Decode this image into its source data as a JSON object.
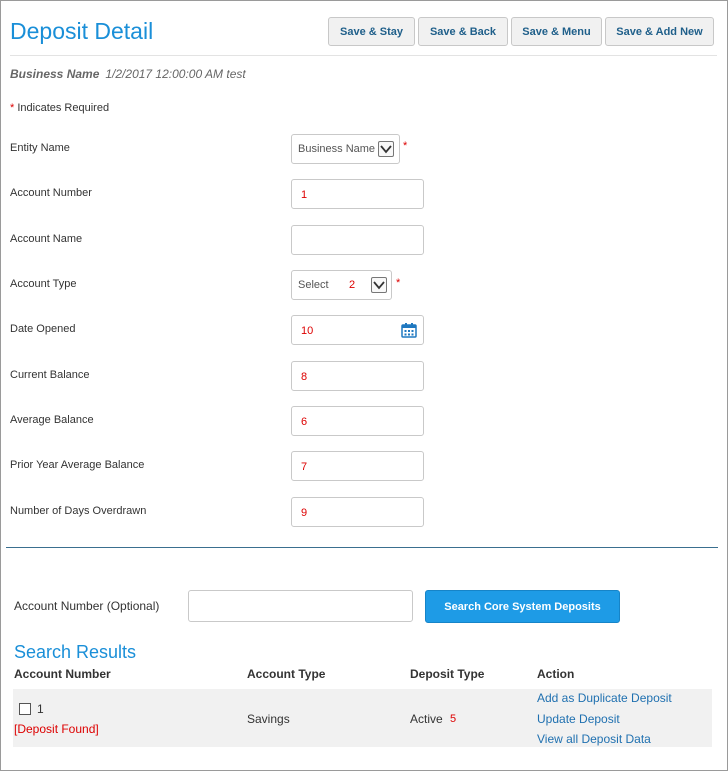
{
  "header": {
    "title": "Deposit Detail",
    "buttons": [
      "Save & Stay",
      "Save & Back",
      "Save & Menu",
      "Save & Add New"
    ]
  },
  "subtitle": {
    "business": "Business Name",
    "info": "1/2/2017 12:00:00 AM test"
  },
  "required_note": {
    "star": "*",
    "text": " Indicates Required"
  },
  "form": {
    "entity_name": {
      "label": "Entity Name",
      "value": "Business Name"
    },
    "account_number": {
      "label": "Account Number",
      "value": "1"
    },
    "account_name": {
      "label": "Account Name",
      "value": ""
    },
    "account_type": {
      "label": "Account Type",
      "value": "Select",
      "annotation": "2"
    },
    "date_opened": {
      "label": "Date Opened",
      "value": "10"
    },
    "current_balance": {
      "label": "Current Balance",
      "value": "8"
    },
    "average_balance": {
      "label": "Average Balance",
      "value": "6"
    },
    "prior_year_average_balance": {
      "label": "Prior Year Average Balance",
      "value": "7"
    },
    "days_overdrawn": {
      "label": "Number of Days Overdrawn",
      "value": "9"
    },
    "required_star": "*"
  },
  "search": {
    "label": "Account Number (Optional)",
    "value": "",
    "button": "Search Core System Deposits"
  },
  "results": {
    "title": "Search Results",
    "columns": [
      "Account Number",
      "Account Type",
      "Deposit Type",
      "Action"
    ],
    "rows": [
      {
        "account_number": "1",
        "status": "[Deposit Found]",
        "account_type": "Savings",
        "deposit_type": "Active",
        "annotation": "5",
        "actions": [
          "Add as Duplicate Deposit",
          "Update Deposit",
          "View all Deposit Data"
        ]
      }
    ]
  },
  "colors": {
    "accent": "#1a8fd8",
    "required": "#dd0000",
    "button": "#1e9be6",
    "link": "#1f70b0"
  },
  "icons": {
    "dropdown": "chevron-down-icon",
    "calendar": "calendar-icon",
    "checkbox": "checkbox-icon"
  }
}
